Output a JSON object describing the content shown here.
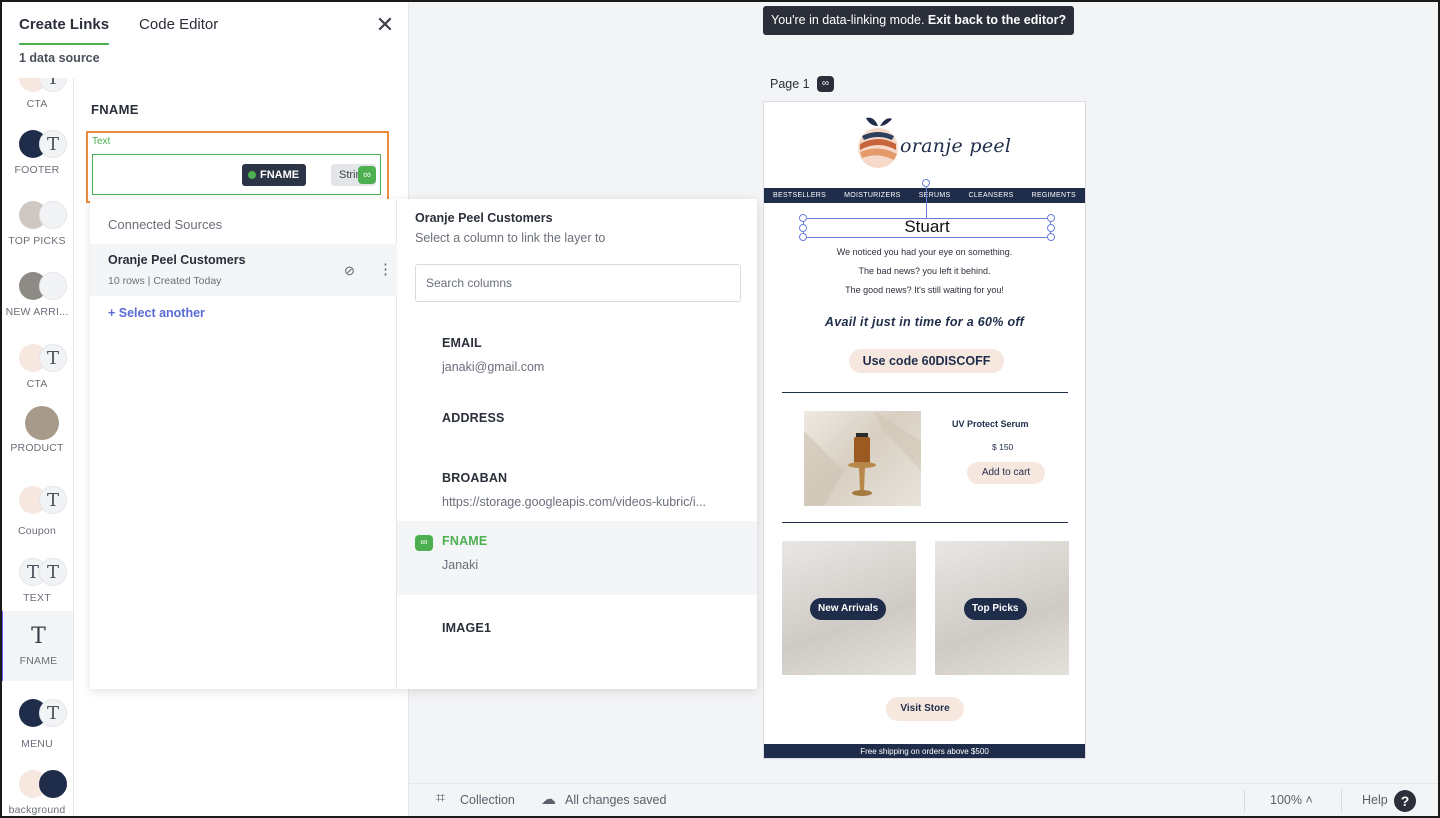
{
  "header": {
    "tabs": [
      {
        "label": "Create Links",
        "active": true
      },
      {
        "label": "Code Editor",
        "active": false
      }
    ],
    "close_icon": "close-icon",
    "data_source_count": "1 data source"
  },
  "layers": [
    {
      "label": "CTA"
    },
    {
      "label": "FOOTER"
    },
    {
      "label": "TOP PICKS"
    },
    {
      "label": "NEW ARRI..."
    },
    {
      "label": "CTA"
    },
    {
      "label": "PRODUCT"
    },
    {
      "label": "Coupon"
    },
    {
      "label": "TEXT"
    },
    {
      "label": "FNAME"
    },
    {
      "label": "MENU"
    },
    {
      "label": "background"
    }
  ],
  "field": {
    "title": "FNAME",
    "type_label": "Text",
    "chip_name": "FNAME",
    "chip_type": "String"
  },
  "sources": {
    "title": "Connected Sources",
    "items": [
      {
        "name": "Oranje Peel Customers",
        "meta": "10 rows | Created Today"
      }
    ],
    "select_another": "+ Select another"
  },
  "columns": {
    "title": "Oranje Peel Customers",
    "subtitle": "Select a column to link the layer to",
    "search_placeholder": "Search columns",
    "items": [
      {
        "name": "EMAIL",
        "value": "janaki@gmail.com",
        "linked": false
      },
      {
        "name": "ADDRESS",
        "value": "",
        "linked": false
      },
      {
        "name": "BROABAN",
        "value": "https://storage.googleapis.com/videos-kubric/i...",
        "linked": false
      },
      {
        "name": "FNAME",
        "value": "Janaki",
        "linked": true
      },
      {
        "name": "IMAGE1",
        "value": "",
        "linked": false
      }
    ]
  },
  "canvas": {
    "banner_text": "You're in data-linking mode.",
    "banner_link": "Exit back to the editor?",
    "page_label": "Page 1"
  },
  "email": {
    "brand": "oranje peel",
    "nav": [
      "BESTSELLERS",
      "MOISTURIZERS",
      "SERUMS",
      "CLEANSERS",
      "REGIMENTS"
    ],
    "name": "Stuart",
    "lines": [
      "We noticed you had your eye on something.",
      "The bad news? you left it behind.",
      "The good news? It's still waiting for you!"
    ],
    "offer": "Avail it just in time for a 60% off",
    "code": "Use code 60DISCOFF",
    "product_name": "UV Protect Serum",
    "product_price": "$ 150",
    "add_to_cart": "Add to cart",
    "tile_new": "New Arrivals",
    "tile_top": "Top Picks",
    "visit": "Visit Store",
    "footer": "Free shipping on orders above $500"
  },
  "bottombar": {
    "collection": "Collection",
    "saved": "All changes saved",
    "zoom": "100%",
    "help": "Help"
  },
  "colors": {
    "accent_green": "#4caf50",
    "highlight_orange": "#ec8a3c",
    "navy": "#1f2d4a",
    "link_blue": "#5b6bd6"
  }
}
